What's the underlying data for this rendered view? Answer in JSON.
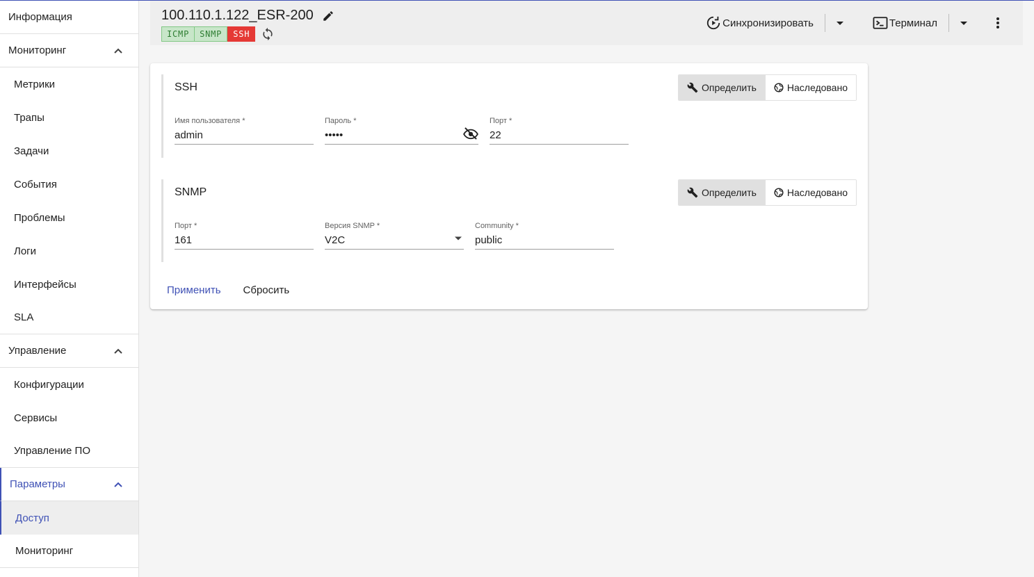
{
  "sidebar": {
    "info": "Информация",
    "monitoring": {
      "label": "Мониторинг",
      "items": [
        "Метрики",
        "Трапы",
        "Задачи",
        "События",
        "Проблемы",
        "Логи",
        "Интерфейсы",
        "SLA"
      ]
    },
    "management": {
      "label": "Управление",
      "items": [
        "Конфигурации",
        "Сервисы",
        "Управление ПО"
      ]
    },
    "parameters": {
      "label": "Параметры",
      "items": [
        "Доступ",
        "Мониторинг"
      ],
      "selected": "Доступ"
    }
  },
  "header": {
    "title": "100.110.1.122_ESR-200",
    "chips": [
      {
        "label": "ICMP",
        "status": "ok"
      },
      {
        "label": "SNMP",
        "status": "ok"
      },
      {
        "label": "SSH",
        "status": "error"
      }
    ],
    "sync_label": "Синхронизировать",
    "terminal_label": "Терминал"
  },
  "ssh": {
    "title": "SSH",
    "define_label": "Определить",
    "inherited_label": "Наследовано",
    "username_label": "Имя пользователя *",
    "username_value": "admin",
    "password_label": "Пароль *",
    "password_value": "•••••",
    "port_label": "Порт *",
    "port_value": "22"
  },
  "snmp": {
    "title": "SNMP",
    "define_label": "Определить",
    "inherited_label": "Наследовано",
    "port_label": "Порт *",
    "port_value": "161",
    "version_label": "Версия SNMP *",
    "version_value": "V2C",
    "community_label": "Community *",
    "community_value": "public"
  },
  "actions": {
    "apply": "Применить",
    "reset": "Сбросить"
  },
  "colors": {
    "accent": "#3f51b5",
    "chip_ok_bg": "#c8e6c9",
    "chip_error_bg": "#e53935"
  }
}
